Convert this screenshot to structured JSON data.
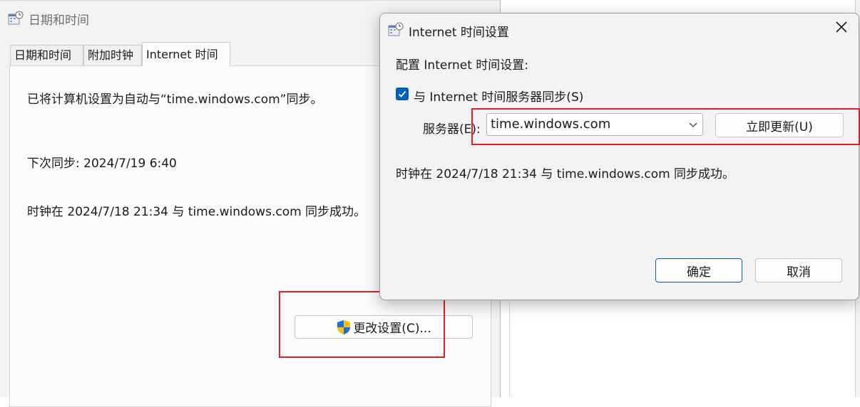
{
  "main_window": {
    "title": "日期和时间",
    "tabs": [
      {
        "label": "日期和时间"
      },
      {
        "label": "附加时钟"
      },
      {
        "label": "Internet 时间"
      }
    ],
    "status_text": "已将计算机设置为自动与“time.windows.com”同步。",
    "next_sync": "下次同步: 2024/7/19 6:40",
    "last_sync": "时钟在 2024/7/18 21:34 与 time.windows.com 同步成功。",
    "change_settings_label": "更改设置(C)..."
  },
  "dialog": {
    "title": "Internet 时间设置",
    "heading": "配置 Internet 时间设置:",
    "sync_checkbox_label": "与 Internet 时间服务器同步(S)",
    "sync_checked": true,
    "server_label": "服务器(E):",
    "server_value": "time.windows.com",
    "update_now_label": "立即更新(U)",
    "result_text": "时钟在 2024/7/18 21:34 与 time.windows.com 同步成功。",
    "ok_label": "确定",
    "cancel_label": "取消"
  },
  "colors": {
    "accent": "#005fb8",
    "highlight_box": "#e0202a"
  },
  "icons": {
    "title_icon": "clock-calendar-icon",
    "shield": "uac-shield-icon",
    "close": "close-icon",
    "dropdown": "chevron-down-icon",
    "check": "checkmark-icon"
  }
}
